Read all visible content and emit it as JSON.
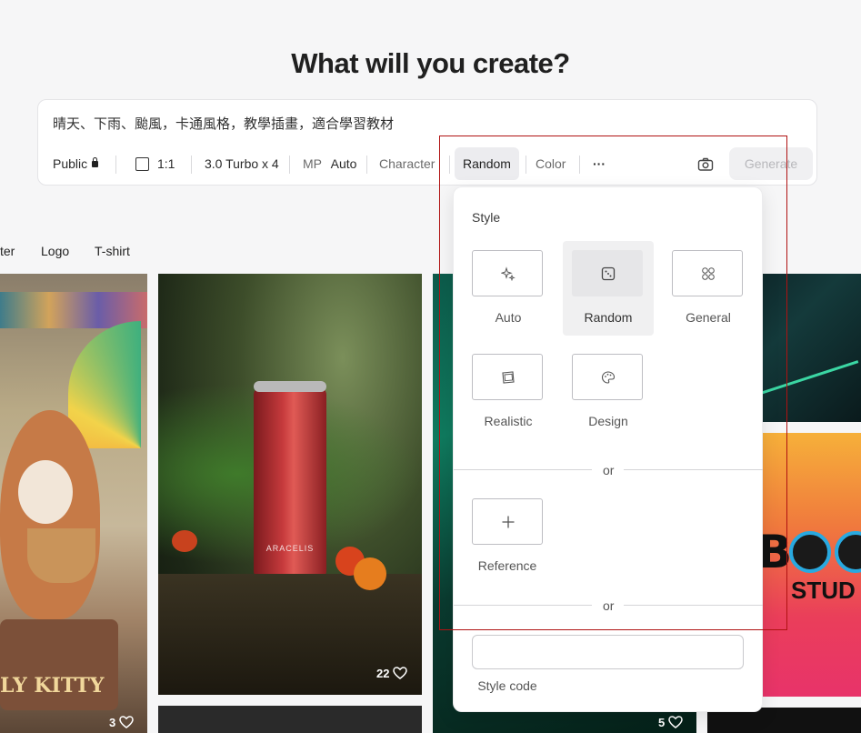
{
  "headline": "What will you create?",
  "prompt": {
    "text": "晴天、下雨、颱風，卡通風格，教學插畫，適合學習教材"
  },
  "toolbar": {
    "visibility": "Public",
    "aspect_ratio": "1:1",
    "model": "3.0 Turbo x 4",
    "mp_label": "MP",
    "mp_value": "Auto",
    "character": "Character",
    "style": "Random",
    "color": "Color",
    "more": "···",
    "generate": "Generate"
  },
  "category_tabs": [
    "ter",
    "Logo",
    "T-shirt"
  ],
  "gallery": {
    "tiles": [
      {
        "caption": "LY KITTY",
        "likes": "3"
      },
      {
        "caption": "ARACELIS",
        "likes": "22"
      },
      {
        "caption": "",
        "likes": "5"
      },
      {
        "caption": "BOO STUD",
        "likes": ""
      }
    ]
  },
  "style_panel": {
    "title": "Style",
    "options": [
      {
        "label": "Auto",
        "icon": "sparkle-icon"
      },
      {
        "label": "Random",
        "icon": "dice-icon",
        "selected": true
      },
      {
        "label": "General",
        "icon": "grid-icon"
      },
      {
        "label": "Realistic",
        "icon": "photo-icon"
      },
      {
        "label": "Design",
        "icon": "palette-icon"
      }
    ],
    "or_1": "or",
    "reference_label": "Reference",
    "or_2": "or",
    "style_code_label": "Style code"
  },
  "colors": {
    "accent_highlight": "#b01212",
    "selected_bg": "#e6e6e8"
  }
}
